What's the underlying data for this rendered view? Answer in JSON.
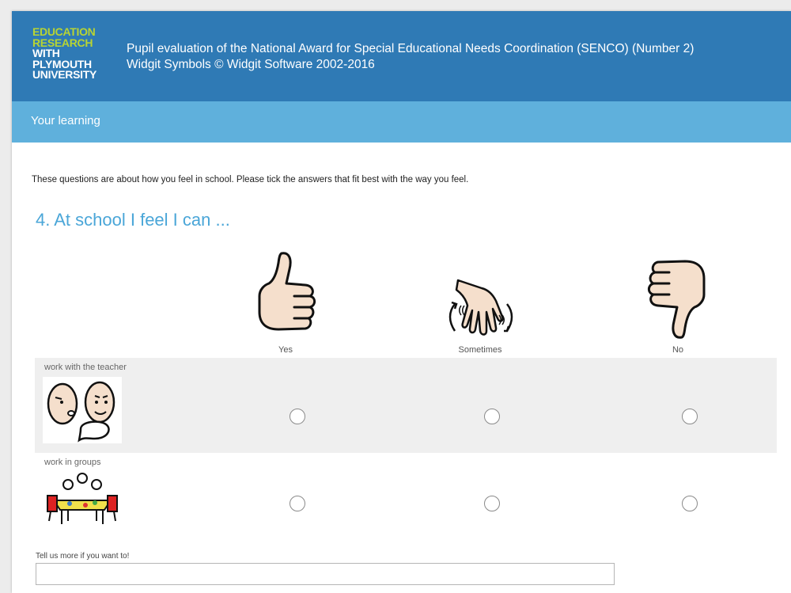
{
  "header": {
    "logo_lines": [
      "EDUCATION",
      "RESEARCH",
      "WITH",
      "PLYMOUTH",
      "UNIVERSITY"
    ],
    "title": "Pupil evaluation of the National Award for Special Educational Needs Coordination (SENCO) (Number 2)",
    "copyright": "Widgit Symbols © Widgit Software 2002-2016"
  },
  "section": {
    "title": "Your learning"
  },
  "intro": "These questions are about how you feel in school. Please tick the answers that fit best with the way you feel.",
  "question": {
    "title": "4. At school I feel I can ...",
    "columns": [
      {
        "label": "Yes",
        "icon": "thumbs-up-icon"
      },
      {
        "label": "Sometimes",
        "icon": "wavering-hand-icon"
      },
      {
        "label": "No",
        "icon": "thumbs-down-icon"
      }
    ],
    "rows": [
      {
        "label": "work with the teacher",
        "icon": "talking-faces-icon"
      },
      {
        "label": "work in groups",
        "icon": "group-table-icon"
      }
    ]
  },
  "more": {
    "label": "Tell us more if you want to!",
    "value": ""
  },
  "colors": {
    "header": "#2f7ab5",
    "subbar": "#5fb0dc",
    "title_accent": "#4aa6d8",
    "logo_green": "#b8d433",
    "row_shade": "#efefef"
  }
}
